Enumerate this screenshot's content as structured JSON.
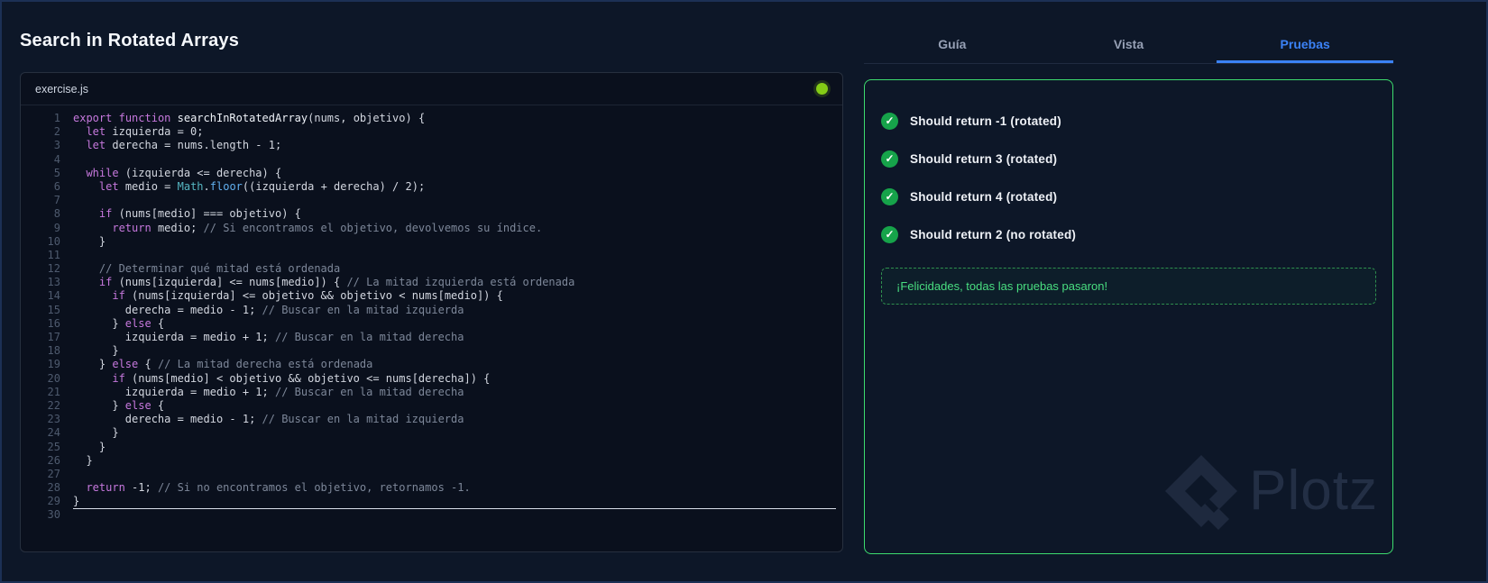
{
  "page_title": "Search in Rotated Arrays",
  "colors": {
    "accent": "#3b82f6",
    "success": "#3ddc6e",
    "check": "#16a34a",
    "status": "#84cc16",
    "keyword": "#c678dd",
    "comment": "#7d8799",
    "builtin": "#56b6c2",
    "method": "#61afef"
  },
  "editor": {
    "filename": "exercise.js",
    "cursor_line": 30,
    "lines": [
      [
        [
          "k",
          "export"
        ],
        [
          "p",
          " "
        ],
        [
          "k",
          "function"
        ],
        [
          "p",
          " "
        ],
        [
          "f",
          "searchInRotatedArray"
        ],
        [
          "p",
          "(nums, objetivo) {"
        ]
      ],
      [
        [
          "p",
          "  "
        ],
        [
          "k",
          "let"
        ],
        [
          "p",
          " izquierda = 0;"
        ]
      ],
      [
        [
          "p",
          "  "
        ],
        [
          "k",
          "let"
        ],
        [
          "p",
          " derecha = nums.length - 1;"
        ]
      ],
      [],
      [
        [
          "p",
          "  "
        ],
        [
          "k",
          "while"
        ],
        [
          "p",
          " (izquierda <= derecha) {"
        ]
      ],
      [
        [
          "p",
          "    "
        ],
        [
          "k",
          "let"
        ],
        [
          "p",
          " medio = "
        ],
        [
          "b",
          "Math"
        ],
        [
          "p",
          "."
        ],
        [
          "m",
          "floor"
        ],
        [
          "p",
          "((izquierda + derecha) / 2);"
        ]
      ],
      [],
      [
        [
          "p",
          "    "
        ],
        [
          "k",
          "if"
        ],
        [
          "p",
          " (nums[medio] === objetivo) {"
        ]
      ],
      [
        [
          "p",
          "      "
        ],
        [
          "k",
          "return"
        ],
        [
          "p",
          " medio; "
        ],
        [
          "c",
          "// Si encontramos el objetivo, devolvemos su índice."
        ]
      ],
      [
        [
          "p",
          "    }"
        ]
      ],
      [],
      [
        [
          "p",
          "    "
        ],
        [
          "c",
          "// Determinar qué mitad está ordenada"
        ]
      ],
      [
        [
          "p",
          "    "
        ],
        [
          "k",
          "if"
        ],
        [
          "p",
          " (nums[izquierda] <= nums[medio]) { "
        ],
        [
          "c",
          "// La mitad izquierda está ordenada"
        ]
      ],
      [
        [
          "p",
          "      "
        ],
        [
          "k",
          "if"
        ],
        [
          "p",
          " (nums[izquierda] <= objetivo && objetivo < nums[medio]) {"
        ]
      ],
      [
        [
          "p",
          "        derecha = medio - 1; "
        ],
        [
          "c",
          "// Buscar en la mitad izquierda"
        ]
      ],
      [
        [
          "p",
          "      } "
        ],
        [
          "k",
          "else"
        ],
        [
          "p",
          " {"
        ]
      ],
      [
        [
          "p",
          "        izquierda = medio + 1; "
        ],
        [
          "c",
          "// Buscar en la mitad derecha"
        ]
      ],
      [
        [
          "p",
          "      }"
        ]
      ],
      [
        [
          "p",
          "    } "
        ],
        [
          "k",
          "else"
        ],
        [
          "p",
          " { "
        ],
        [
          "c",
          "// La mitad derecha está ordenada"
        ]
      ],
      [
        [
          "p",
          "      "
        ],
        [
          "k",
          "if"
        ],
        [
          "p",
          " (nums[medio] < objetivo && objetivo <= nums[derecha]) {"
        ]
      ],
      [
        [
          "p",
          "        izquierda = medio + 1; "
        ],
        [
          "c",
          "// Buscar en la mitad derecha"
        ]
      ],
      [
        [
          "p",
          "      } "
        ],
        [
          "k",
          "else"
        ],
        [
          "p",
          " {"
        ]
      ],
      [
        [
          "p",
          "        derecha = medio - 1; "
        ],
        [
          "c",
          "// Buscar en la mitad izquierda"
        ]
      ],
      [
        [
          "p",
          "      }"
        ]
      ],
      [
        [
          "p",
          "    }"
        ]
      ],
      [
        [
          "p",
          "  }"
        ]
      ],
      [],
      [
        [
          "p",
          "  "
        ],
        [
          "k",
          "return"
        ],
        [
          "p",
          " -1; "
        ],
        [
          "c",
          "// Si no encontramos el objetivo, retornamos -1."
        ]
      ],
      [
        [
          "p",
          "}"
        ]
      ],
      []
    ]
  },
  "tabs": [
    {
      "id": "guia",
      "label": "Guía",
      "active": false
    },
    {
      "id": "vista",
      "label": "Vista",
      "active": false
    },
    {
      "id": "pruebas",
      "label": "Pruebas",
      "active": true
    }
  ],
  "tests": {
    "items": [
      "Should return -1 (rotated)",
      "Should return 3 (rotated)",
      "Should return 4 (rotated)",
      "Should return 2 (no rotated)"
    ],
    "success_message": "¡Felicidades, todas las pruebas pasaron!"
  },
  "watermark": {
    "text": "Plotz"
  }
}
